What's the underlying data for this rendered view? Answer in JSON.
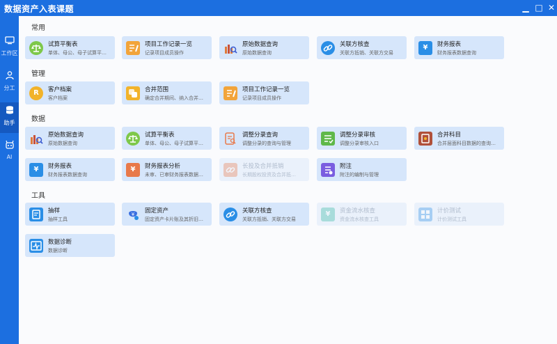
{
  "window": {
    "title": "数据资产入表课题",
    "minimize": "▁",
    "maximize": "□",
    "close": "✕"
  },
  "sidebar": {
    "items": [
      {
        "label": "工作区",
        "icon": "monitor-icon"
      },
      {
        "label": "分工",
        "icon": "users-icon"
      },
      {
        "label": "助手",
        "icon": "database-icon",
        "active": true
      },
      {
        "label": "AI",
        "icon": "robot-icon"
      }
    ]
  },
  "sections": {
    "common": {
      "title": "常用",
      "cards": [
        {
          "name": "试算平衡表",
          "desc": "单体、母公、母子试算平…",
          "icon": "scale-icon",
          "color": "#7ec84a"
        },
        {
          "name": "项目工作记录一览",
          "desc": "记录项目成员操作",
          "icon": "notepad-icon",
          "color": "#f2a43a"
        },
        {
          "name": "原始数据查询",
          "desc": "原始数据查询",
          "icon": "data-search-icon",
          "color": "#e07a3a"
        },
        {
          "name": "关联方核查",
          "desc": "关联方抵销、关联方交易",
          "icon": "link-icon",
          "color": "#2a8ee6"
        },
        {
          "name": "财务报表",
          "desc": "财务报表数据查询",
          "icon": "finance-report-icon",
          "color": "#2a8ee6"
        }
      ]
    },
    "manage": {
      "title": "管理",
      "cards": [
        {
          "name": "客户档案",
          "desc": "客户档案",
          "icon": "customer-file-icon",
          "color": "#f2b32a"
        },
        {
          "name": "合并范围",
          "desc": "确定合并期间、纳入合并…",
          "icon": "merge-scope-icon",
          "color": "#f2b32a"
        },
        {
          "name": "项目工作记录一览",
          "desc": "记录项目成员操作",
          "icon": "notepad-icon",
          "color": "#f2a43a"
        }
      ]
    },
    "data": {
      "title": "数据",
      "cards": [
        {
          "name": "原始数据查询",
          "desc": "原始数据查询",
          "icon": "data-search-icon",
          "color": "#e07a3a"
        },
        {
          "name": "试算平衡表",
          "desc": "单体、母公、母子试算平…",
          "icon": "scale-icon",
          "color": "#7ec84a"
        },
        {
          "name": "调整分录查询",
          "desc": "调整分录的查询与管理",
          "icon": "entry-search-icon",
          "color": "#e8794a"
        },
        {
          "name": "调整分录审核",
          "desc": "调整分录审核入口",
          "icon": "entry-review-icon",
          "color": "#5fb84a"
        },
        {
          "name": "合并科目",
          "desc": "合并层面科目数据的查询…",
          "icon": "merge-account-icon",
          "color": "#b0503a"
        },
        {
          "name": "财务报表",
          "desc": "财务报表数据查询",
          "icon": "finance-report-icon",
          "color": "#2a8ee6"
        },
        {
          "name": "财务报表分析",
          "desc": "未审、已审财务报表数据…",
          "icon": "report-analysis-icon",
          "color": "#e8794a"
        },
        {
          "name": "长投及合并抵销",
          "desc": "长期股权投资及合并抵…",
          "icon": "investment-offset-icon",
          "color": "#e8794a",
          "disabled": true
        },
        {
          "name": "附注",
          "desc": "附注的编制与管理",
          "icon": "notes-icon",
          "color": "#7a5de0"
        }
      ]
    },
    "tools": {
      "title": "工具",
      "cards": [
        {
          "name": "抽样",
          "desc": "抽样工具",
          "icon": "sampling-icon",
          "color": "#2a8ee6"
        },
        {
          "name": "固定资产",
          "desc": "固定资产卡片账及其折旧…",
          "icon": "fixed-asset-icon",
          "color": "#3a6fe0"
        },
        {
          "name": "关联方核查",
          "desc": "关联方抵销、关联方交易",
          "icon": "link-icon",
          "color": "#2a8ee6"
        },
        {
          "name": "资金流水核查",
          "desc": "资金流水核查工具",
          "icon": "cash-flow-icon",
          "color": "#2fb8a0",
          "disabled": true
        },
        {
          "name": "计价测试",
          "desc": "计价测试工具",
          "icon": "pricing-test-icon",
          "color": "#2a8ee6",
          "disabled": true
        },
        {
          "name": "数据诊断",
          "desc": "数据诊断",
          "icon": "data-diagnosis-icon",
          "color": "#2a8ee6"
        }
      ]
    }
  }
}
